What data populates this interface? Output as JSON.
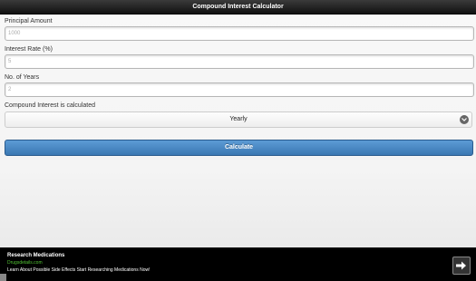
{
  "header": {
    "title": "Compound Interest Calculator"
  },
  "form": {
    "principal_label": "Principal Amount",
    "principal_placeholder": "1000",
    "rate_label": "Interest Rate (%)",
    "rate_placeholder": "5",
    "years_label": "No. of Years",
    "years_placeholder": "2",
    "frequency_label": "Compound Interest is calculated",
    "frequency_selected": "Yearly",
    "calculate_label": "Calculate"
  },
  "ad": {
    "title": "Research Medications",
    "url": "Drugsdetails.com",
    "description": "Learn About Possible Side Effects Start Researching Medications Now!"
  },
  "icons": {
    "dropdown": "chevron-down-icon",
    "ad_arrow": "arrow-right-icon"
  },
  "colors": {
    "accent": "#3b78b3",
    "header": "#1a1a1a",
    "ad_url": "#52c234"
  }
}
